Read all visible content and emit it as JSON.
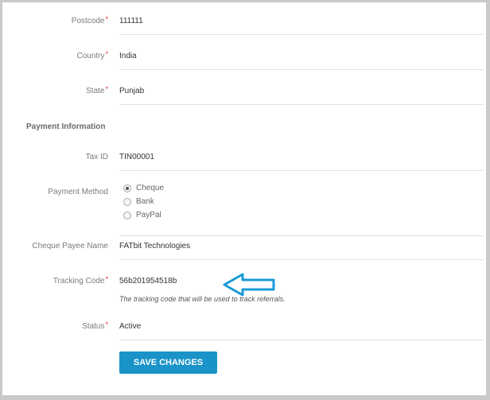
{
  "address": {
    "postcode": {
      "label": "Postcode",
      "value": "111111",
      "required": true
    },
    "country": {
      "label": "Country",
      "value": "India",
      "required": true
    },
    "state": {
      "label": "State",
      "value": "Punjab",
      "required": true
    }
  },
  "payment": {
    "section_title": "Payment Information",
    "tax_id": {
      "label": "Tax ID",
      "value": "TIN00001"
    },
    "method": {
      "label": "Payment Method",
      "options": [
        "Cheque",
        "Bank",
        "PayPal"
      ],
      "selected": "Cheque"
    },
    "cheque_payee": {
      "label": "Cheque Payee Name",
      "value": "FATbit Technologies"
    },
    "tracking": {
      "label": "Tracking Code",
      "value": "56b201954518b",
      "required": true,
      "hint": "The tracking code that will be used to track referrals."
    },
    "status": {
      "label": "Status",
      "value": "Active",
      "required": true
    }
  },
  "actions": {
    "save_label": "SAVE CHANGES"
  },
  "colors": {
    "accent": "#1993c8",
    "required": "#dd3333",
    "annotation_arrow": "#1a9ad6"
  },
  "annotation": {
    "icon": "arrow-left-icon"
  }
}
